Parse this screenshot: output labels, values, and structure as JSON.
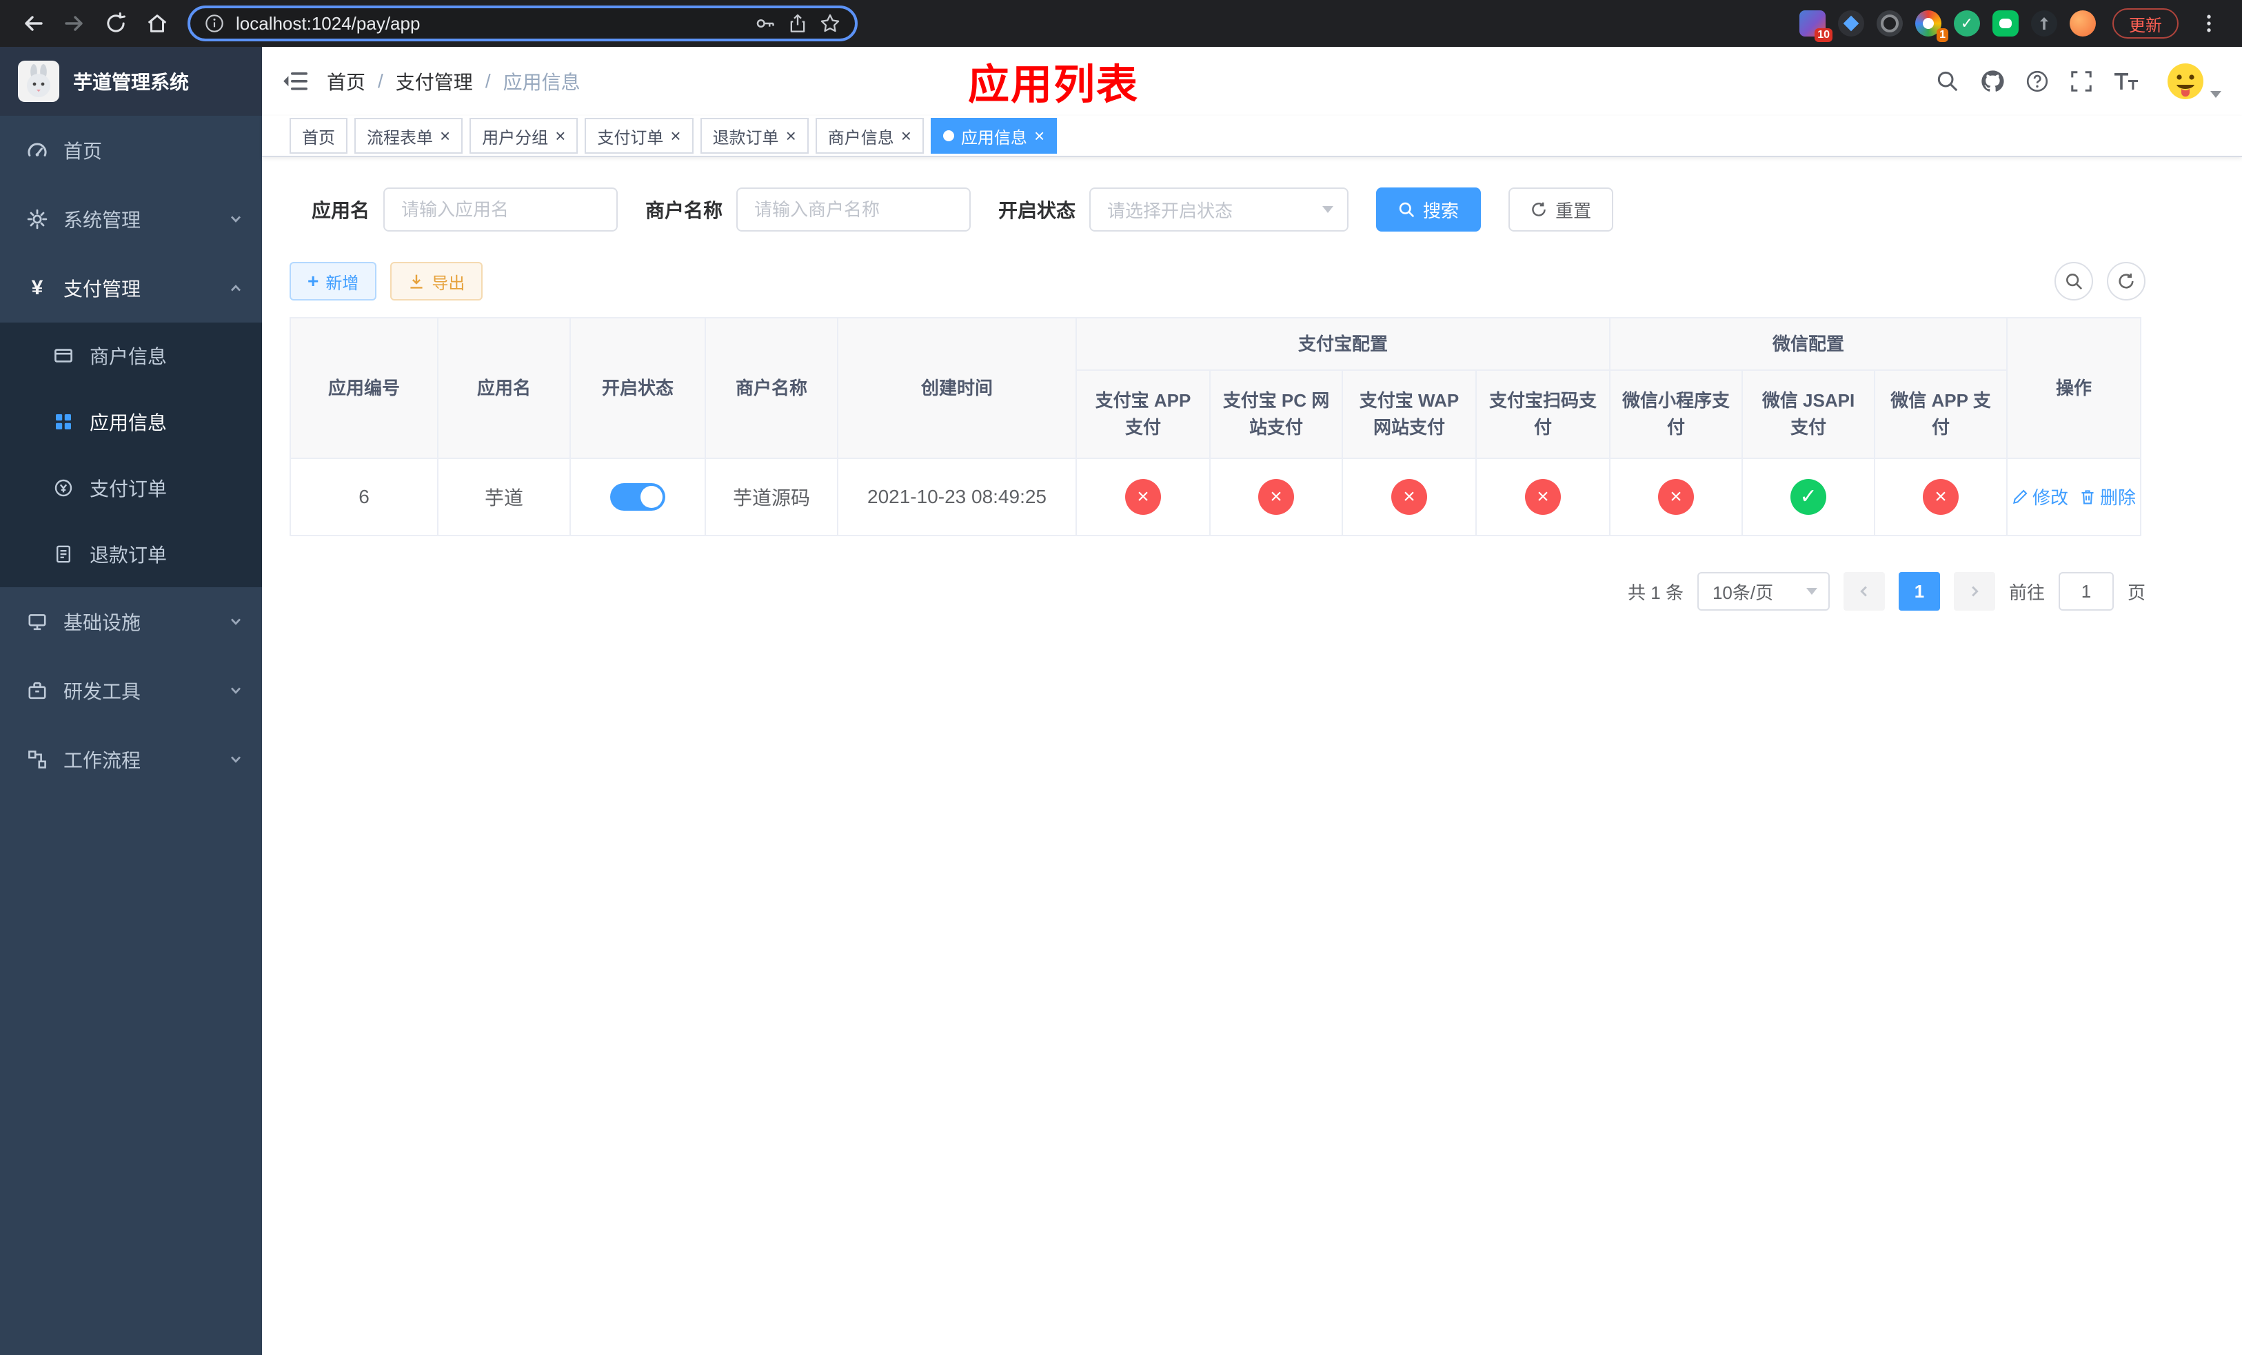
{
  "icons": {
    "close": "×",
    "check": "✓",
    "cross": "×",
    "plus": "+",
    "yen": "¥"
  },
  "browser": {
    "url": "localhost:1024/pay/app",
    "update_button": "更新",
    "extension_badges": {
      "first": "10",
      "fourth": "1"
    }
  },
  "sidebar": {
    "logo_title": "芋道管理系统",
    "items": [
      {
        "label": "首页"
      },
      {
        "label": "系统管理"
      },
      {
        "label": "支付管理"
      },
      {
        "label": "基础设施"
      },
      {
        "label": "研发工具"
      },
      {
        "label": "工作流程"
      }
    ],
    "payment_children": [
      {
        "label": "商户信息"
      },
      {
        "label": "应用信息"
      },
      {
        "label": "支付订单"
      },
      {
        "label": "退款订单"
      }
    ]
  },
  "header": {
    "breadcrumb": [
      "首页",
      "支付管理",
      "应用信息"
    ],
    "breadcrumb_separator": "/",
    "overlay_title": "应用列表"
  },
  "tabs": [
    {
      "label": "首页"
    },
    {
      "label": "流程表单"
    },
    {
      "label": "用户分组"
    },
    {
      "label": "支付订单"
    },
    {
      "label": "退款订单"
    },
    {
      "label": "商户信息"
    },
    {
      "label": "应用信息"
    }
  ],
  "filters": {
    "app_name_label": "应用名",
    "app_name_placeholder": "请输入应用名",
    "merchant_label": "商户名称",
    "merchant_placeholder": "请输入商户名称",
    "status_label": "开启状态",
    "status_placeholder": "请选择开启状态",
    "search_button": "搜索",
    "reset_button": "重置"
  },
  "toolbar": {
    "add_button": "新增",
    "export_button": "导出"
  },
  "table": {
    "headers": {
      "app_id": "应用编号",
      "app_name": "应用名",
      "status": "开启状态",
      "merchant": "商户名称",
      "created": "创建时间",
      "alipay_group": "支付宝配置",
      "wechat_group": "微信配置",
      "alipay_app": "支付宝 APP 支付",
      "alipay_pc": "支付宝 PC 网站支付",
      "alipay_wap": "支付宝 WAP 网站支付",
      "alipay_scan": "支付宝扫码支付",
      "wechat_mini": "微信小程序支付",
      "wechat_jsapi": "微信 JSAPI 支付",
      "wechat_app": "微信 APP 支付",
      "actions": "操作"
    },
    "rows": [
      {
        "app_id": "6",
        "app_name": "芋道",
        "enabled": true,
        "merchant": "芋道源码",
        "created": "2021-10-23 08:49:25",
        "statuses": [
          false,
          false,
          false,
          false,
          false,
          true,
          false
        ],
        "edit_label": "修改",
        "delete_label": "删除"
      }
    ]
  },
  "pagination": {
    "total": "共 1 条",
    "page_size": "10条/页",
    "current_page": "1",
    "goto_label": "前往",
    "goto_value": "1",
    "page_unit": "页"
  }
}
